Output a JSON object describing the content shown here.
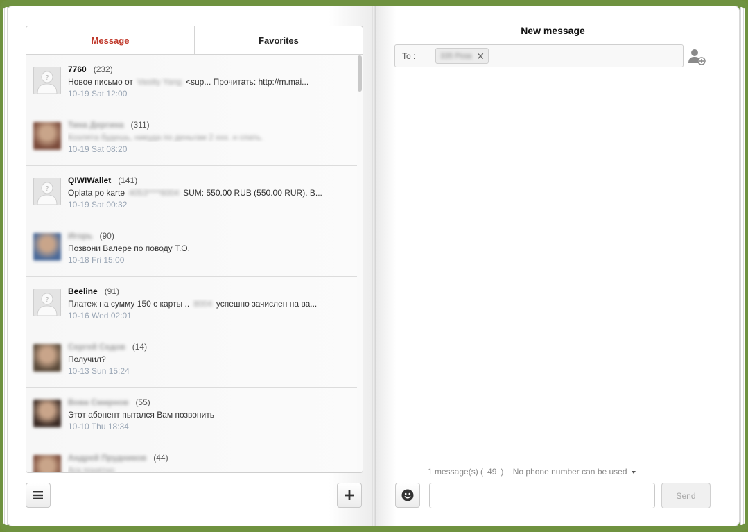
{
  "colors": {
    "frame": "#6f9240",
    "active_tab": "#c0392b",
    "time": "#9aa6b5"
  },
  "tabs": [
    {
      "label": "Message",
      "active": true
    },
    {
      "label": "Favorites",
      "active": false
    }
  ],
  "messages": [
    {
      "name": "7760",
      "count": "(232)",
      "preview_a": "Новое письмо от",
      "preview_blur": "Vasiliy Yang",
      "preview_b": "<sup... Прочитать: http://m.mai...",
      "time": "10-19 Sat 12:00",
      "avatar": "default",
      "name_blurred": false
    },
    {
      "name": "Тина Дергина",
      "count": "(311)",
      "preview_a": "",
      "preview_blur": "Козлята будешь, никуда по деньгам 2 ххх. н спать.",
      "preview_b": "",
      "time": "10-19 Sat 08:20",
      "avatar": "photo",
      "name_blurred": true
    },
    {
      "name": "QIWIWallet",
      "count": "(141)",
      "preview_a": "Oplata po karte",
      "preview_blur": "4053****6004",
      "preview_b": "SUM: 550.00 RUB (550.00 RUR). B...",
      "time": "10-19 Sat 00:32",
      "avatar": "default",
      "name_blurred": false
    },
    {
      "name": "Игорь",
      "count": "(90)",
      "preview_a": "Позвони Валере по поводу Т.О.",
      "preview_blur": "",
      "preview_b": "",
      "time": "10-18 Fri 15:00",
      "avatar": "photo",
      "name_blurred": true
    },
    {
      "name": "Beeline",
      "count": "(91)",
      "preview_a": "Платеж на сумму 150 с карты ..",
      "preview_blur": "8004",
      "preview_b": "успешно зачислен на ва...",
      "time": "10-16 Wed 02:01",
      "avatar": "default",
      "name_blurred": false
    },
    {
      "name": "Сергей Седов",
      "count": "(14)",
      "preview_a": "Получил?",
      "preview_blur": "",
      "preview_b": "",
      "time": "10-13 Sun 15:24",
      "avatar": "photo",
      "name_blurred": true
    },
    {
      "name": "Вова Смирнов",
      "count": "(55)",
      "preview_a": "Этот абонент пытался Вам позвонить",
      "preview_blur": "",
      "preview_b": "",
      "time": "10-10 Thu 18:34",
      "avatar": "photo",
      "name_blurred": true
    },
    {
      "name": "Андрей Прудников",
      "count": "(44)",
      "preview_a": "",
      "preview_blur": "Ага понятно",
      "preview_b": "",
      "time": "",
      "avatar": "photo",
      "name_blurred": true
    }
  ],
  "compose": {
    "title": "New message",
    "to_label": "To :",
    "recipient_chip": "335 Роза",
    "chip_close": "✕",
    "status_prefix": "1 message(s) (",
    "status_count": "49",
    "status_suffix": ")",
    "phone_select": "No phone number can be used",
    "input_value": "",
    "send_label": "Send"
  },
  "icons": {
    "menu": "menu-icon",
    "add": "plus-icon",
    "emoji": "smiley-icon",
    "add_contact": "add-contact-icon",
    "avatar_default": "user-placeholder-icon"
  }
}
